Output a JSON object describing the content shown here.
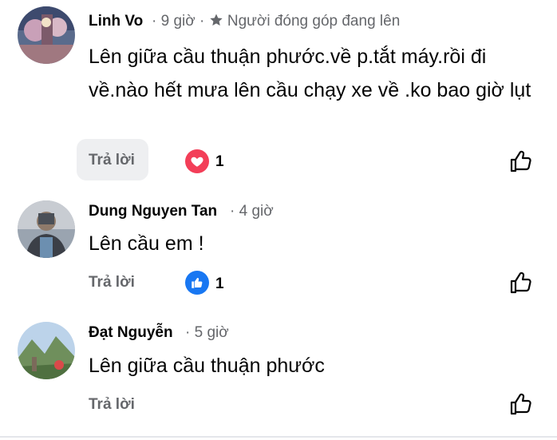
{
  "comments": [
    {
      "author": "Linh Vo",
      "time": "9 giờ",
      "badge_icon": "star-icon",
      "badge_label": "Người đóng góp đang lên",
      "text": "Lên giữa cầu thuận phước.về p.tắt máy.rồi đi về.nào hết mưa lên cầu chạy xe về .ko bao giờ lụt",
      "reply_label": "Trả lời",
      "reaction_icon": "heart-icon",
      "reaction_color": "#f33e58",
      "reaction_count": "1"
    },
    {
      "author": "Dung Nguyen Tan",
      "time": "4 giờ",
      "text": "Lên cầu em !",
      "reply_label": "Trả lời",
      "reaction_icon": "thumbs-up-icon",
      "reaction_color": "#1877f2",
      "reaction_count": "1"
    },
    {
      "author": "Đạt Nguyễn",
      "time": "5 giờ",
      "text": "Lên giữa cầu thuận phước",
      "reply_label": "Trả lời"
    }
  ],
  "separator": "·"
}
